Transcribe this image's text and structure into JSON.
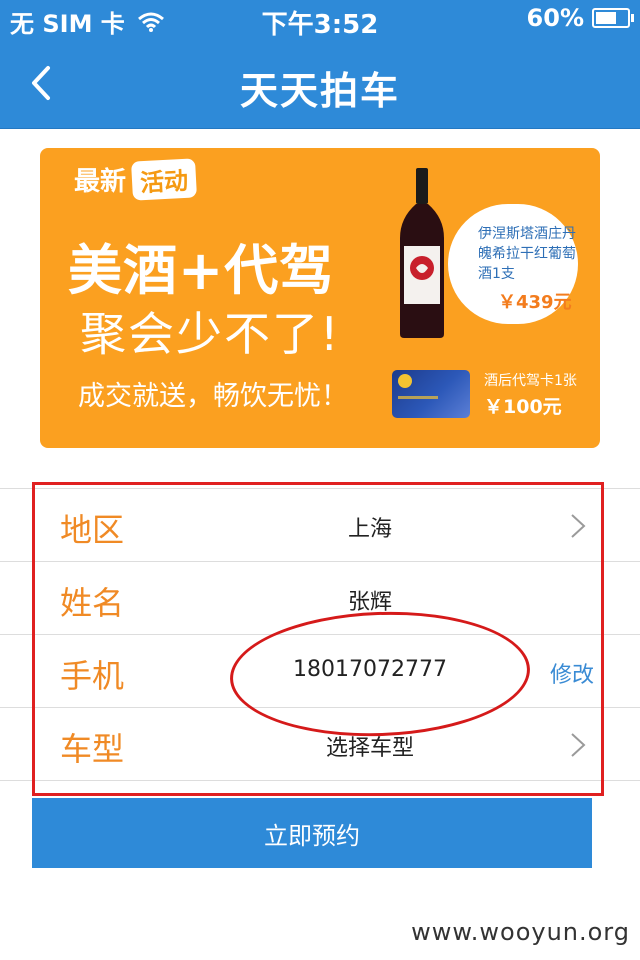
{
  "status_bar": {
    "carrier": "无 SIM 卡",
    "time": "下午3:52",
    "battery": "60%",
    "battery_level": 0.6
  },
  "nav": {
    "title": "天天拍车"
  },
  "banner": {
    "tag_new": "最新",
    "tag_activity": "活动",
    "headline": "美酒+代驾",
    "subheadline": "聚会少不了!",
    "slogan": "成交就送，畅饮无忧！",
    "wine_desc": "伊涅斯塔酒庄丹魄希拉干红葡萄酒1支",
    "wine_price": "￥439元",
    "card_desc": "酒后代驾卡1张",
    "card_price": "￥100元",
    "brand_color": "#fba020"
  },
  "form": {
    "rows": [
      {
        "label": "地区",
        "value": "上海"
      },
      {
        "label": "姓名",
        "value": "张辉"
      },
      {
        "label": "手机",
        "value": "18017072777",
        "action": "修改"
      },
      {
        "label": "车型",
        "value": "选择车型"
      }
    ]
  },
  "submit": {
    "label": "立即预约"
  },
  "watermark": "www.wooyun.org",
  "colors": {
    "primary": "#2e8ad8",
    "label_orange": "#f08a25",
    "annotation_red": "#e02020"
  }
}
